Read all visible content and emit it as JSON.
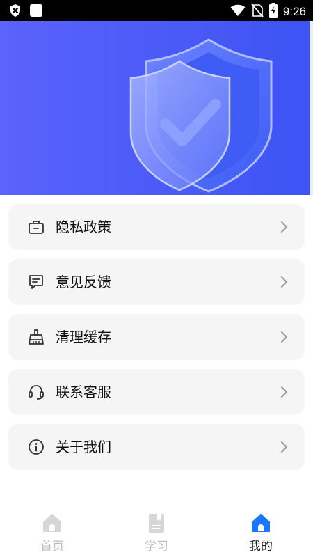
{
  "status_bar": {
    "time": "9:26"
  },
  "menu": {
    "items": [
      {
        "label": "隐私政策",
        "icon": "briefcase-icon"
      },
      {
        "label": "意见反馈",
        "icon": "message-icon"
      },
      {
        "label": "清理缓存",
        "icon": "broom-icon"
      },
      {
        "label": "联系客服",
        "icon": "headset-icon"
      },
      {
        "label": "关于我们",
        "icon": "info-icon"
      }
    ]
  },
  "tabbar": {
    "tabs": [
      {
        "label": "首页",
        "icon": "home-icon",
        "active": false
      },
      {
        "label": "学习",
        "icon": "book-icon",
        "active": false
      },
      {
        "label": "我的",
        "icon": "home-icon",
        "active": true
      }
    ]
  },
  "colors": {
    "banner_start": "#5a63fb",
    "banner_end": "#3f55f5",
    "active_tab": "#1976ff",
    "inactive_tab": "#d6d6d6",
    "card_bg": "#f5f5f5"
  }
}
